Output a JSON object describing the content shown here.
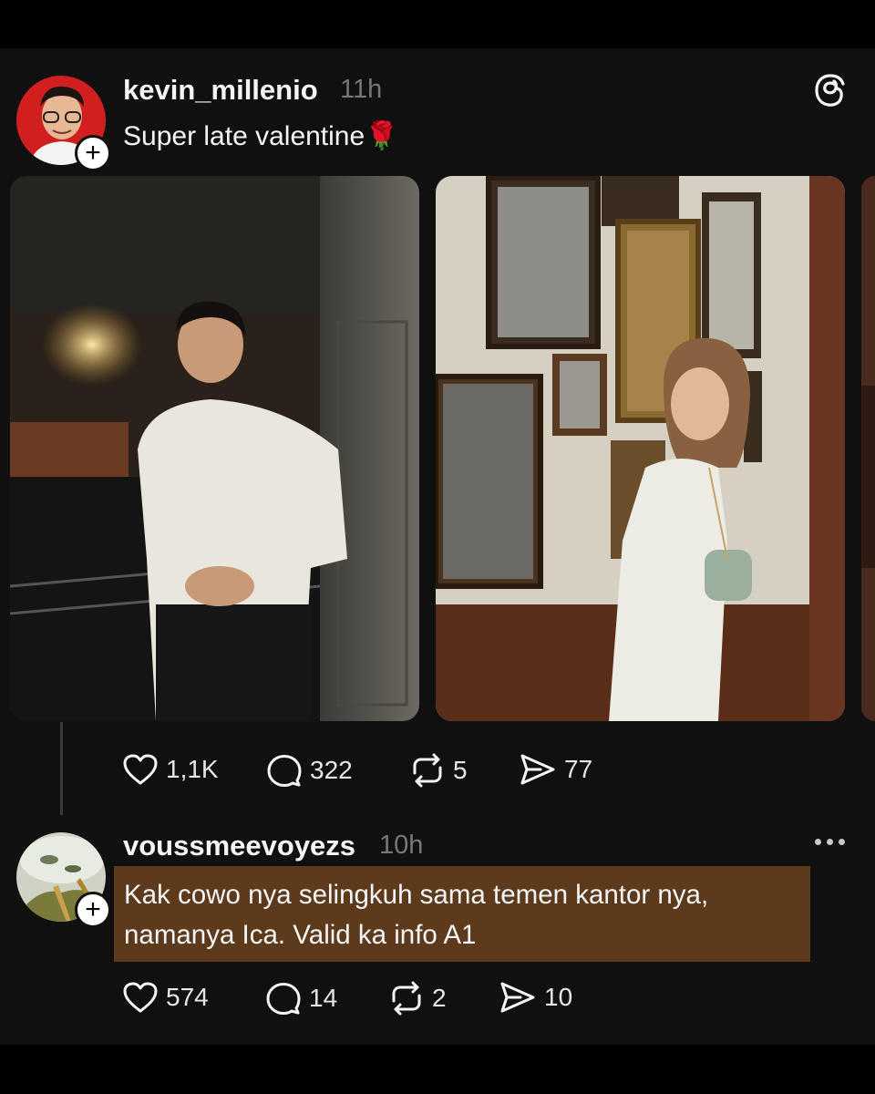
{
  "post": {
    "username": "kevin_millenio",
    "time": "11h",
    "text": "Super late valentine🌹",
    "actions": {
      "likes": "1,1K",
      "replies": "322",
      "reposts": "5",
      "shares": "77"
    }
  },
  "reply": {
    "username": "voussmeevoyezs",
    "time": "10h",
    "text_line1": "Kak cowo nya selingkuh sama temen kantor nya,",
    "text_line2": "namanya Ica. Valid ka info A1",
    "actions": {
      "likes": "574",
      "replies": "14",
      "reposts": "2",
      "shares": "10"
    }
  },
  "icons": {
    "app_logo": "threads-logo-icon",
    "follow": "plus-icon",
    "more": "more-options-icon",
    "like": "heart-icon",
    "reply": "comment-icon",
    "repost": "repost-icon",
    "share": "send-icon"
  },
  "colors": {
    "background": "#101010",
    "highlight": "#5e3a1d",
    "muted": "#777777"
  }
}
